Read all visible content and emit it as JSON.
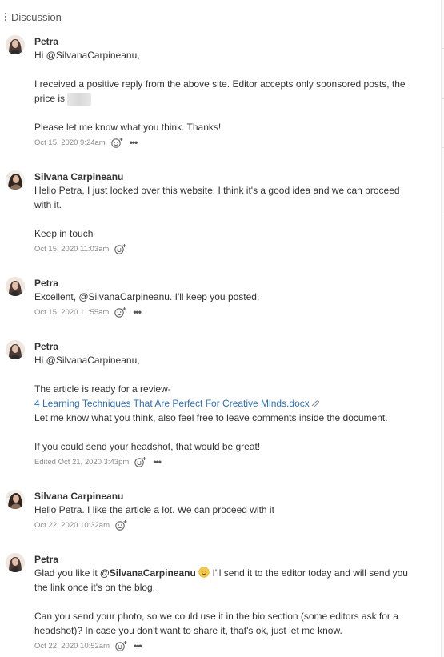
{
  "header": {
    "title": "Discussion"
  },
  "comments": [
    {
      "author": "Petra",
      "line1": "Hi @SilvanaCarpineanu,",
      "line2a": "I received a positive reply from the above site. Editor accepts only sponsored posts, the",
      "line2b": "price is",
      "line3": "Please let me know what you think. Thanks!",
      "time": "Oct 15, 2020 9:24am"
    },
    {
      "author": "Silvana Carpineanu",
      "line1": "Hello Petra, I just looked over this website. I think it's a good idea and we can proceed",
      "line1b": "with it.",
      "line2": "Keep in touch",
      "time": "Oct 15, 2020 11:03am"
    },
    {
      "author": "Petra",
      "line1": "Excellent, @SilvanaCarpineanu. I'll keep you posted.",
      "time": "Oct 15, 2020 11:55am"
    },
    {
      "author": "Petra",
      "line1": "Hi @SilvanaCarpineanu,",
      "line2": "The article is ready for a review-",
      "link": "4 Learning Techniques That Are Perfect For Creative Minds.docx",
      "line3": "Let me know what you think, also feel free to leave comments inside the document.",
      "line4": "If you could send your headshot, that would be great!",
      "time": "Edited Oct 21, 2020 3:43pm"
    },
    {
      "author": "Silvana Carpineanu",
      "line1": "Hello Petra. I like the article a lot. We can proceed with it",
      "time": "Oct 22, 2020 10:32am"
    },
    {
      "author": "Petra",
      "line1a": "Glad you like it",
      "mention": "@SilvanaCarpineanu",
      "line1b": "I'll send it to the editor today and will send you",
      "line1c": "the link once it's on the blog.",
      "line2a": "Can you send your photo, so we could use it in the bio section (some editors ask for a",
      "line2b": "headshot)? In case you don't want to share it, that's ok, just let me know.",
      "time": "Oct 22, 2020 10:52am"
    }
  ],
  "icons": {
    "drag_handle": "kebab-vertical-icon",
    "reaction": "add-reaction-icon",
    "more": "more-horizontal-icon",
    "attachment": "paperclip-icon",
    "emoji": "slightly-smiling-face-emoji"
  },
  "colors": {
    "link": "#2f6fb8",
    "meta": "#8a8a8a",
    "text": "#333333"
  }
}
